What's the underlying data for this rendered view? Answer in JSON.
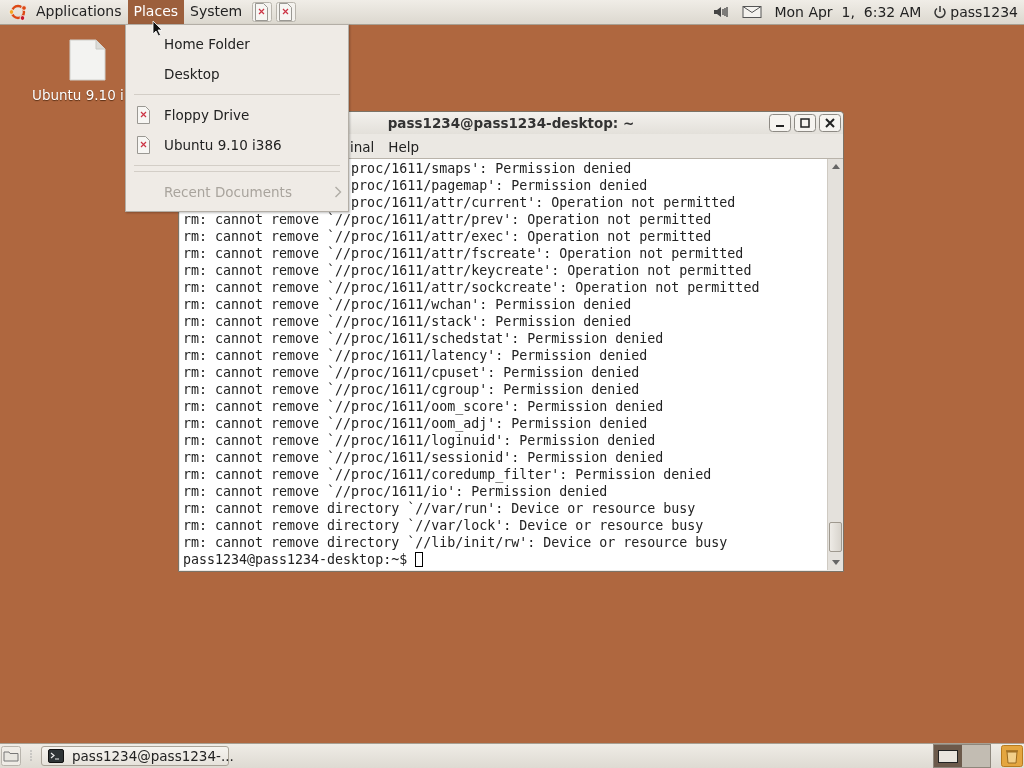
{
  "top_panel": {
    "menus": [
      {
        "label": "Applications",
        "selected": false
      },
      {
        "label": "Places",
        "selected": true
      },
      {
        "label": "System",
        "selected": false
      }
    ],
    "clock": "Mon Apr  1,  6:32 AM",
    "user": "pass1234"
  },
  "desktop_icons": [
    {
      "label": "Ubuntu 9.10 i"
    }
  ],
  "terminal": {
    "title": "pass1234@pass1234-desktop: ~",
    "menus": [
      {
        "kind": "partial",
        "label": "inal"
      },
      {
        "kind": "menu",
        "label": "Help"
      }
    ],
    "lines": [
      {
        "kind": "partial",
        "text": "proc/1611/smaps': Permission denied"
      },
      {
        "kind": "partial",
        "text": "proc/1611/pagemap': Permission denied"
      },
      {
        "kind": "partial",
        "text": "proc/1611/attr/current': Operation not permitted"
      },
      {
        "kind": "full",
        "text": "rm: cannot remove `//proc/1611/attr/prev': Operation not permitted"
      },
      {
        "kind": "full",
        "text": "rm: cannot remove `//proc/1611/attr/exec': Operation not permitted"
      },
      {
        "kind": "full",
        "text": "rm: cannot remove `//proc/1611/attr/fscreate': Operation not permitted"
      },
      {
        "kind": "full",
        "text": "rm: cannot remove `//proc/1611/attr/keycreate': Operation not permitted"
      },
      {
        "kind": "full",
        "text": "rm: cannot remove `//proc/1611/attr/sockcreate': Operation not permitted"
      },
      {
        "kind": "full",
        "text": "rm: cannot remove `//proc/1611/wchan': Permission denied"
      },
      {
        "kind": "full",
        "text": "rm: cannot remove `//proc/1611/stack': Permission denied"
      },
      {
        "kind": "full",
        "text": "rm: cannot remove `//proc/1611/schedstat': Permission denied"
      },
      {
        "kind": "full",
        "text": "rm: cannot remove `//proc/1611/latency': Permission denied"
      },
      {
        "kind": "full",
        "text": "rm: cannot remove `//proc/1611/cpuset': Permission denied"
      },
      {
        "kind": "full",
        "text": "rm: cannot remove `//proc/1611/cgroup': Permission denied"
      },
      {
        "kind": "full",
        "text": "rm: cannot remove `//proc/1611/oom_score': Permission denied"
      },
      {
        "kind": "full",
        "text": "rm: cannot remove `//proc/1611/oom_adj': Permission denied"
      },
      {
        "kind": "full",
        "text": "rm: cannot remove `//proc/1611/loginuid': Permission denied"
      },
      {
        "kind": "full",
        "text": "rm: cannot remove `//proc/1611/sessionid': Permission denied"
      },
      {
        "kind": "full",
        "text": "rm: cannot remove `//proc/1611/coredump_filter': Permission denied"
      },
      {
        "kind": "full",
        "text": "rm: cannot remove `//proc/1611/io': Permission denied"
      },
      {
        "kind": "full",
        "text": "rm: cannot remove directory `//var/run': Device or resource busy"
      },
      {
        "kind": "full",
        "text": "rm: cannot remove directory `//var/lock': Device or resource busy"
      },
      {
        "kind": "full",
        "text": "rm: cannot remove directory `//lib/init/rw': Device or resource busy"
      }
    ],
    "prompt": "pass1234@pass1234-desktop:~$"
  },
  "places_menu": {
    "items": [
      {
        "kind": "item",
        "label": "Home Folder",
        "disabled": false
      },
      {
        "kind": "item",
        "label": "Desktop",
        "disabled": false
      },
      {
        "kind": "separator"
      },
      {
        "kind": "drive",
        "label": "Floppy Drive",
        "disabled": false
      },
      {
        "kind": "drive",
        "label": "Ubuntu 9.10 i386",
        "disabled": false
      },
      {
        "kind": "separator"
      },
      {
        "kind": "separator"
      },
      {
        "kind": "submenu",
        "label": "Recent Documents",
        "disabled": true
      }
    ]
  },
  "bottom_panel": {
    "tasks": [
      {
        "label": "pass1234@pass1234-...",
        "selected": false
      }
    ],
    "workspaces": [
      {
        "selected": true
      },
      {
        "selected": false
      }
    ]
  }
}
